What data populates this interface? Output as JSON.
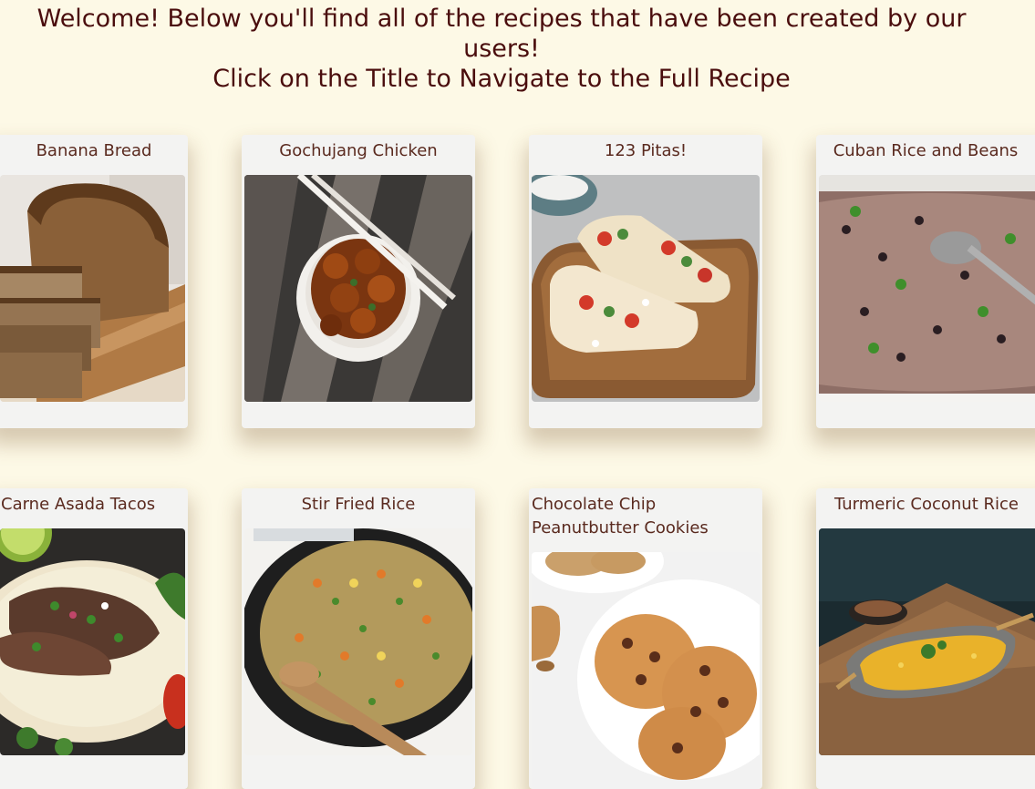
{
  "header": {
    "line1": "Welcome! Below you'll find all of the recipes that have been created by our users!",
    "line2": "Click on the Title to Navigate to the Full Recipe"
  },
  "recipes": [
    {
      "title": "Banana Bread",
      "image_alt": "banana-bread-photo"
    },
    {
      "title": "Gochujang Chicken",
      "image_alt": "gochujang-chicken-photo"
    },
    {
      "title": "123 Pitas!",
      "image_alt": "pitas-photo"
    },
    {
      "title": "Cuban Rice and Beans",
      "image_alt": "rice-and-beans-photo"
    },
    {
      "title": "Carne Asada Tacos",
      "image_alt": "carne-asada-tacos-photo"
    },
    {
      "title": "Stir Fried Rice",
      "image_alt": "stir-fried-rice-photo"
    },
    {
      "title": "Chocolate Chip Peanutbutter Cookies",
      "image_alt": "cookies-photo"
    },
    {
      "title": "Turmeric Coconut Rice",
      "image_alt": "turmeric-rice-photo"
    }
  ]
}
